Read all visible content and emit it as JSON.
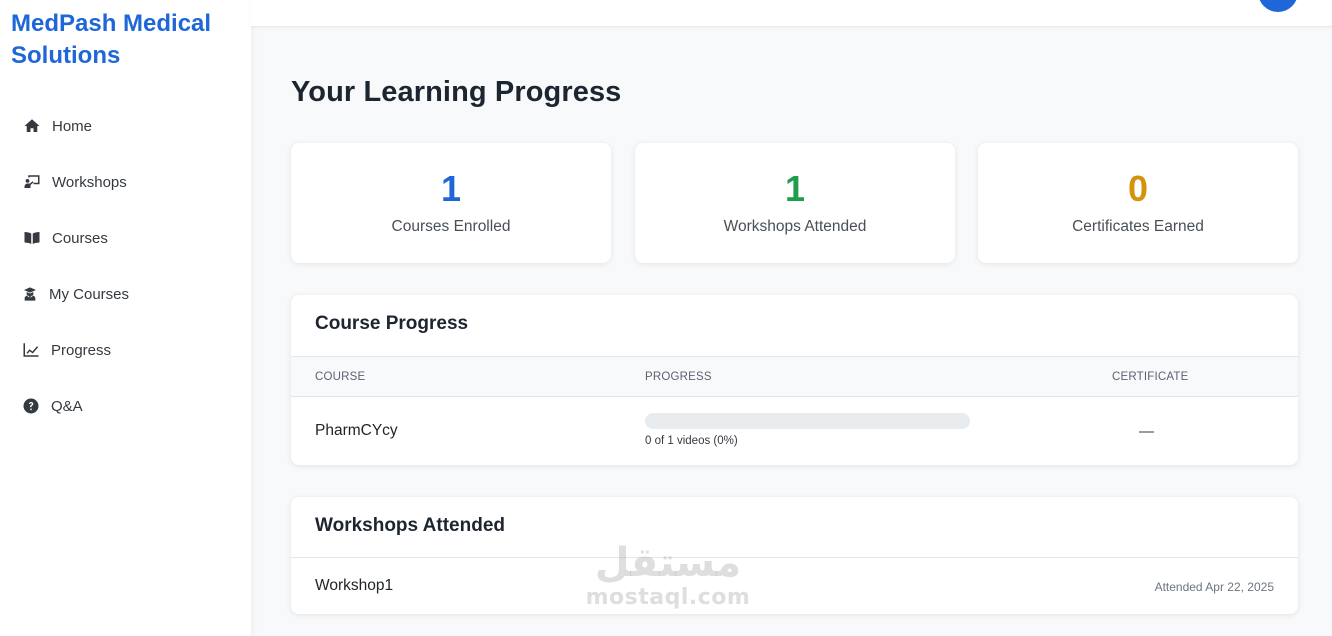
{
  "brand": {
    "line1": "MedPash Medical",
    "line2": "Solutions"
  },
  "colors": {
    "accent": "#1f67d8",
    "green": "#1e9e4a",
    "gold": "#d4930a"
  },
  "sidebar": {
    "items": [
      {
        "label": "Home",
        "icon": "home-icon"
      },
      {
        "label": "Workshops",
        "icon": "presentation-icon"
      },
      {
        "label": "Courses",
        "icon": "book-icon"
      },
      {
        "label": "My Courses",
        "icon": "graduate-icon"
      },
      {
        "label": "Progress",
        "icon": "chart-line-icon"
      },
      {
        "label": "Q&A",
        "icon": "question-circle-icon"
      }
    ]
  },
  "main": {
    "title": "Your Learning Progress",
    "stats": [
      {
        "value": "1",
        "label": "Courses Enrolled"
      },
      {
        "value": "1",
        "label": "Workshops Attended"
      },
      {
        "value": "0",
        "label": "Certificates Earned"
      }
    ],
    "course_progress": {
      "title": "Course Progress",
      "headers": {
        "course": "COURSE",
        "progress": "PROGRESS",
        "certificate": "CERTIFICATE"
      },
      "rows": [
        {
          "course": "PharmCYcy",
          "progress_fraction": 0,
          "progress_text": "0 of 1 videos (0%)",
          "certificate": "—"
        }
      ]
    },
    "workshops": {
      "title": "Workshops Attended",
      "rows": [
        {
          "name": "Workshop1",
          "date": "Attended Apr 22, 2025"
        }
      ]
    }
  },
  "watermark": {
    "arabic": "مستقل",
    "latin": "mostaql.com"
  }
}
